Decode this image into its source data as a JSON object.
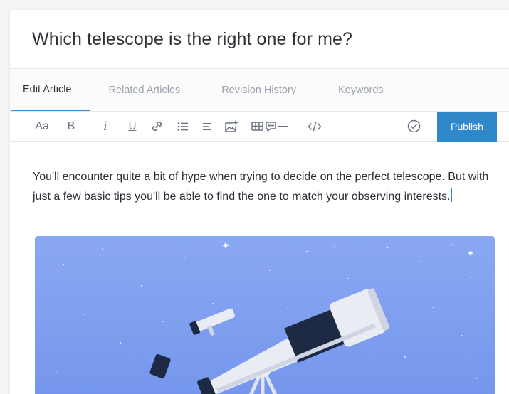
{
  "article": {
    "title": "Which telescope is the right one for me?",
    "body": "You'll encounter quite a bit of hype when trying to decide on the perfect telescope. But with just a few basic tips you'll be able to find the one to match your observing interests."
  },
  "tabs": [
    {
      "label": "Edit Article",
      "active": true
    },
    {
      "label": "Related Articles",
      "active": false
    },
    {
      "label": "Revision History",
      "active": false
    },
    {
      "label": "Keywords",
      "active": false
    }
  ],
  "toolbar": {
    "font_label": "Aa",
    "bold_label": "B",
    "italic_label": "i",
    "underline_label": "U",
    "publish_label": "Publish",
    "icons": [
      "link-icon",
      "bulleted-list-icon",
      "align-icon",
      "add-image-icon",
      "table-icon",
      "comment-icon",
      "horizontal-rule-icon",
      "code-icon",
      "check-circle-icon"
    ]
  },
  "colors": {
    "accent": "#2e88c9",
    "illustration_bg": "#7d9ff0",
    "telescope_body": "#e9ecf3",
    "telescope_dark": "#1e2a44"
  }
}
